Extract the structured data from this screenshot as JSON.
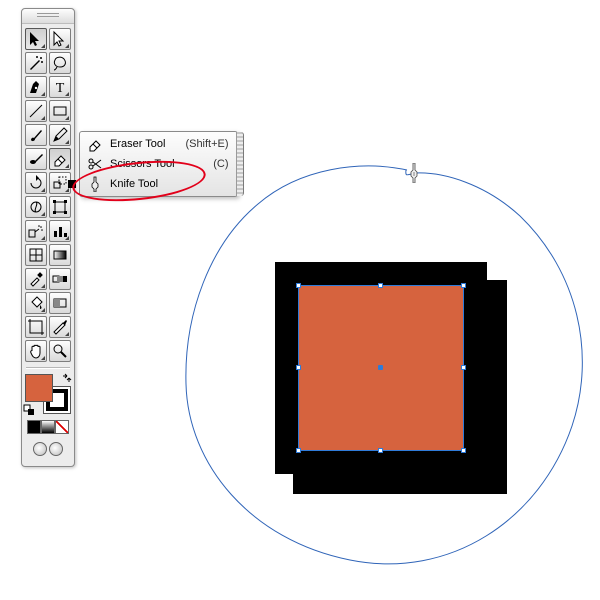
{
  "colors": {
    "fill": "#d6633e",
    "stroke": "#000000",
    "selection_accent": "#2f7bd9",
    "annotation": "#e2001a"
  },
  "flyout": {
    "items": [
      {
        "name": "Eraser Tool",
        "shortcut": "(Shift+E)",
        "icon": "eraser",
        "selected": false
      },
      {
        "name": "Scissors Tool",
        "shortcut": "(C)",
        "icon": "scissors",
        "selected": false
      },
      {
        "name": "Knife Tool",
        "shortcut": "",
        "icon": "knife",
        "selected": true
      }
    ]
  },
  "palette_row_count": 15,
  "canvas": {
    "lasso_visible": true,
    "selected_shape": "orange-square",
    "cursor": "knife"
  }
}
